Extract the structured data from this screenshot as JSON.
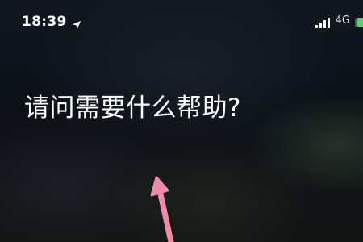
{
  "status_bar": {
    "time": "18:39",
    "location_icon": "location-arrow-icon",
    "signal_icon": "cellular-signal-icon",
    "network": "4G",
    "battery_icon": "battery-icon",
    "battery_color": "#4cd964"
  },
  "siri": {
    "prompt": "请问需要什么帮助?"
  },
  "annotation": {
    "icon": "pink-arrow-icon",
    "color": "#f08aa8"
  }
}
